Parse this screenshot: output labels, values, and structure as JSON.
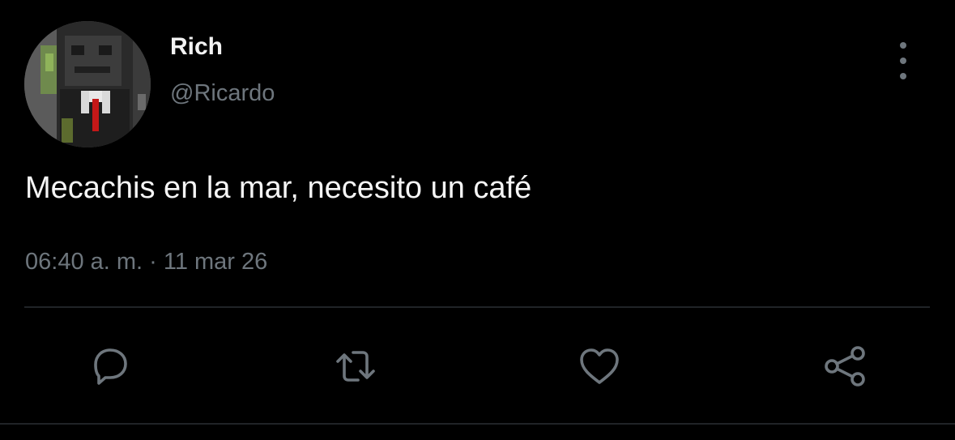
{
  "author": {
    "display_name": "Rich",
    "handle": "@Ricardo",
    "avatar_icon": "pixel-character-avatar"
  },
  "tweet": {
    "text": "Mecachis en la mar, necesito un café",
    "timestamp": "06:40 a. m. · 11 mar 26"
  },
  "actions": [
    {
      "name": "reply",
      "icon": "speech-bubble-icon"
    },
    {
      "name": "retweet",
      "icon": "retweet-arrows-icon"
    },
    {
      "name": "like",
      "icon": "heart-icon"
    },
    {
      "name": "share",
      "icon": "share-nodes-icon"
    }
  ],
  "colors": {
    "background": "#000000",
    "primary_text": "#f5f5f5",
    "secondary_text": "#6e767d",
    "divider": "#202327"
  }
}
